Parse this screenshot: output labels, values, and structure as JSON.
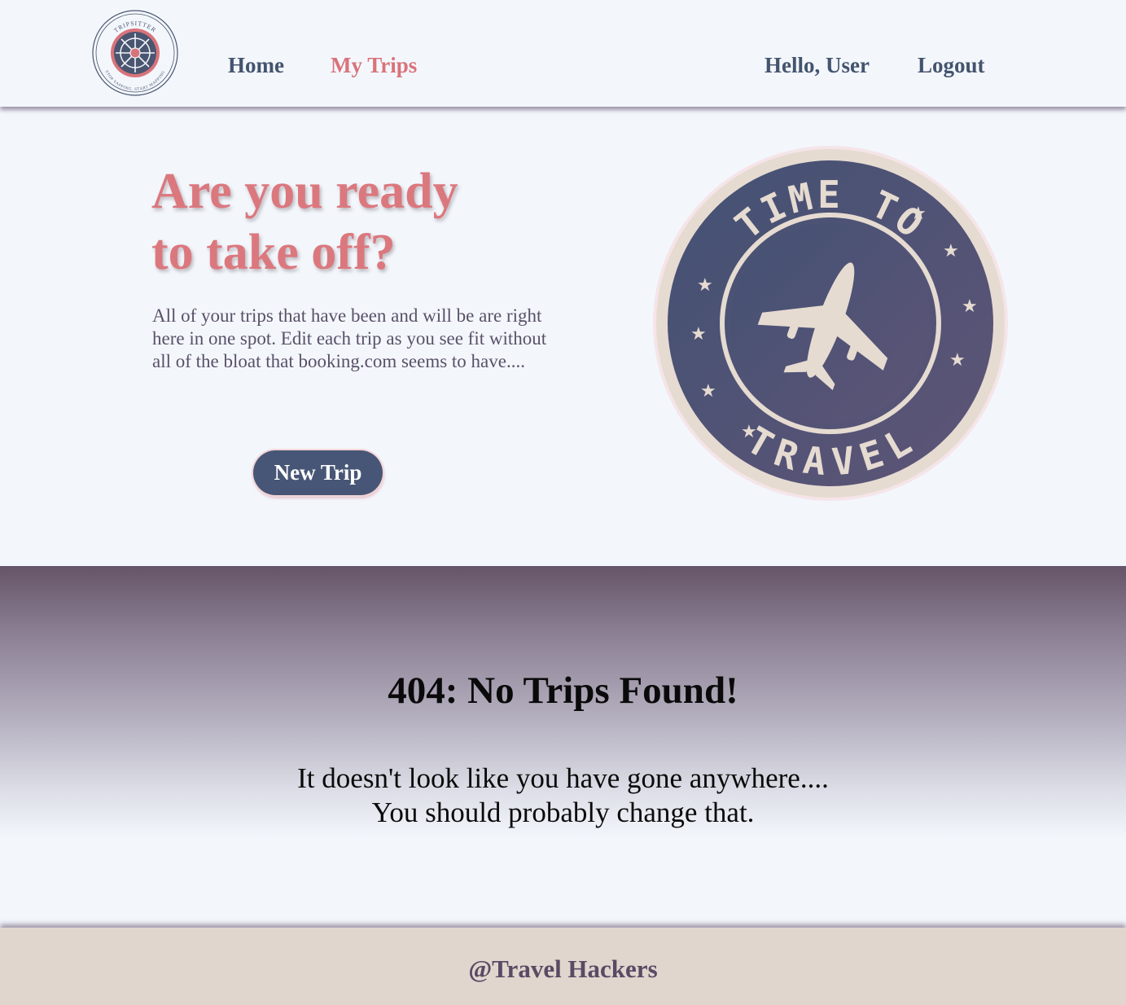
{
  "nav": {
    "logo_top_text": "TRIPSITTER",
    "logo_bottom_text": "STOP YAPPING, START MAPPING",
    "home": "Home",
    "my_trips": "My Trips",
    "greeting": "Hello, User",
    "logout": "Logout"
  },
  "hero": {
    "title_line1": "Are you ready",
    "title_line2": "to take off?",
    "description": "All of your trips that have been and will be are right here in one spot. Edit each trip as you see fit without all of the bloat that booking.com seems to have....",
    "new_trip_button": "New Trip",
    "stamp_top": "TIME TO",
    "stamp_bottom": "TRAVEL"
  },
  "empty_state": {
    "title": "404: No Trips Found!",
    "line1": "It doesn't look like you have gone anywhere....",
    "line2": "You should probably change that."
  },
  "footer": {
    "credit": "@Travel Hackers"
  },
  "colors": {
    "accent_pink": "#db787e",
    "navy": "#475676",
    "footer_bg": "#e1d6ce",
    "page_bg": "#f3f7fc"
  }
}
